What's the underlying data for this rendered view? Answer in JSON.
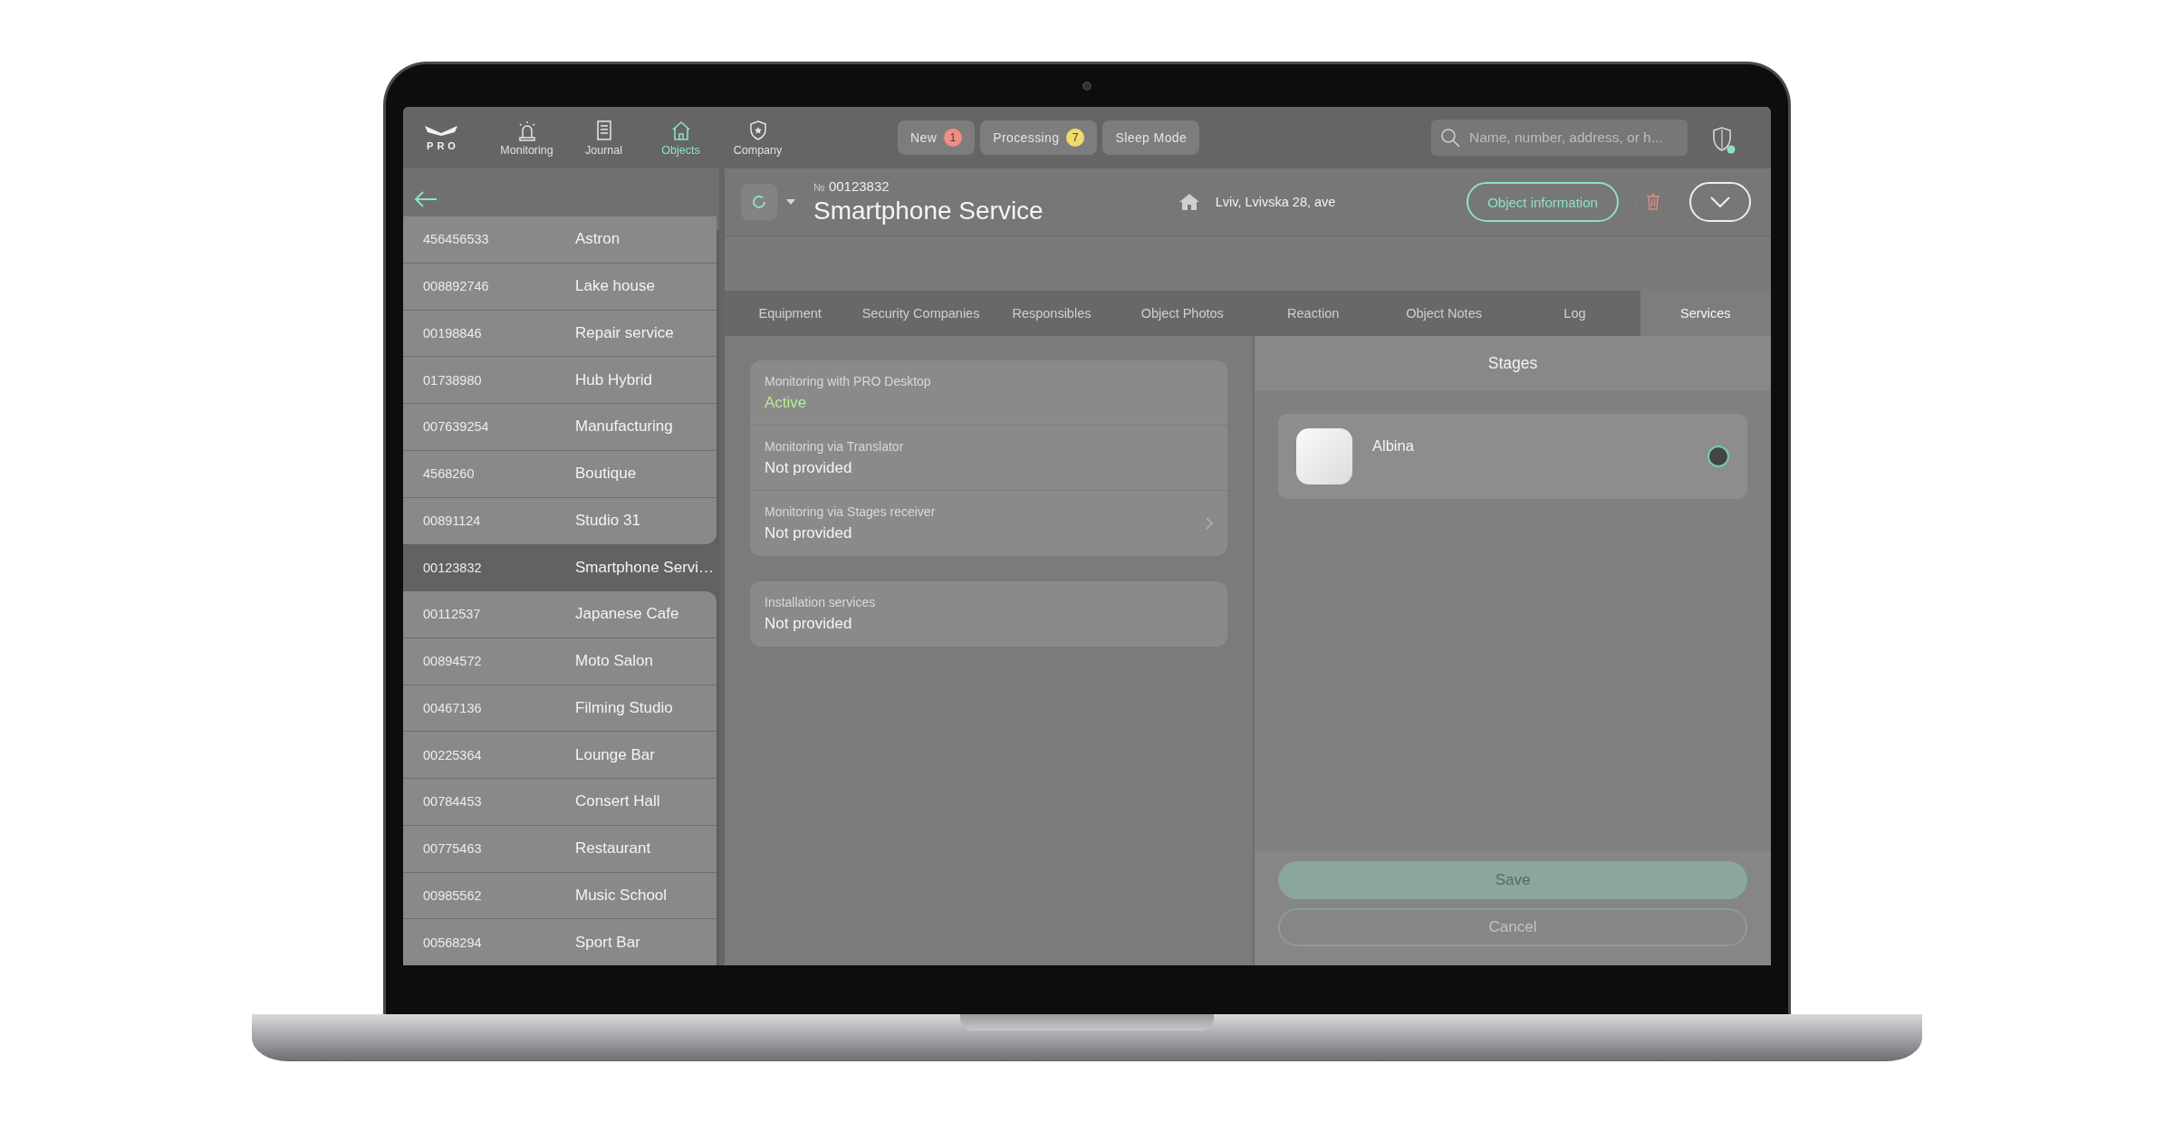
{
  "nav": {
    "logo_text": "PRO",
    "items": [
      {
        "label": "Monitoring",
        "selected": false
      },
      {
        "label": "Journal",
        "selected": false
      },
      {
        "label": "Objects",
        "selected": true
      },
      {
        "label": "Company",
        "selected": false
      }
    ]
  },
  "status_buttons": [
    {
      "label": "New",
      "count": "1",
      "color": "#f08e86"
    },
    {
      "label": "Processing",
      "count": "7",
      "color": "#f2d96b"
    },
    {
      "label": "Sleep Mode"
    }
  ],
  "search": {
    "placeholder": "Name, number, address, or h..."
  },
  "sidebar": {
    "objects": [
      {
        "number": "456456533",
        "name": "Astron",
        "selected": false
      },
      {
        "number": "008892746",
        "name": "Lake house",
        "selected": false
      },
      {
        "number": "00198846",
        "name": "Repair service",
        "selected": false
      },
      {
        "number": "01738980",
        "name": "Hub Hybrid",
        "selected": false
      },
      {
        "number": "007639254",
        "name": "Manufacturing",
        "selected": false
      },
      {
        "number": "4568260",
        "name": "Boutique",
        "selected": false
      },
      {
        "number": "00891124",
        "name": "Studio 31",
        "selected": false
      },
      {
        "number": "00123832",
        "name": "Smartphone Servi…",
        "selected": true
      },
      {
        "number": "00112537",
        "name": "Japanese Cafe",
        "selected": false
      },
      {
        "number": "00894572",
        "name": "Moto Salon",
        "selected": false
      },
      {
        "number": "00467136",
        "name": "Filming Studio",
        "selected": false
      },
      {
        "number": "00225364",
        "name": "Lounge Bar",
        "selected": false
      },
      {
        "number": "00784453",
        "name": "Consert Hall",
        "selected": false
      },
      {
        "number": "00775463",
        "name": "Restaurant",
        "selected": false
      },
      {
        "number": "00985562",
        "name": "Music School",
        "selected": false
      },
      {
        "number": "00568294",
        "name": "Sport Bar",
        "selected": false
      }
    ]
  },
  "object": {
    "number_sign": "№",
    "number": "00123832",
    "title": "Smartphone Service",
    "address": "Lviv, Lvivska 28, ave",
    "info_button": "Object information"
  },
  "tabs": [
    {
      "label": "Equipment",
      "selected": false
    },
    {
      "label": "Security Companies",
      "selected": false
    },
    {
      "label": "Responsibles",
      "selected": false
    },
    {
      "label": "Object Photos",
      "selected": false
    },
    {
      "label": "Reaction",
      "selected": false
    },
    {
      "label": "Object Notes",
      "selected": false
    },
    {
      "label": "Log",
      "selected": false
    },
    {
      "label": "Services",
      "selected": true
    }
  ],
  "services": {
    "groups": [
      [
        {
          "label": "Monitoring with PRO Desktop",
          "value": "Active",
          "kind": "active",
          "has_chevron": false
        },
        {
          "label": "Monitoring via Translator",
          "value": "Not provided",
          "kind": "inactive",
          "has_chevron": false
        },
        {
          "label": "Monitoring via Stages receiver",
          "value": "Not provided",
          "kind": "inactive",
          "has_chevron": true
        }
      ],
      [
        {
          "label": "Installation services",
          "value": "Not provided",
          "kind": "inactive",
          "has_chevron": false
        }
      ]
    ]
  },
  "stages": {
    "title": "Stages",
    "devices": [
      {
        "name": "Albina",
        "selected": false
      }
    ]
  },
  "actions": {
    "save": {
      "label": "Save",
      "disabled": true
    },
    "cancel": {
      "label": "Cancel",
      "disabled": true
    }
  }
}
